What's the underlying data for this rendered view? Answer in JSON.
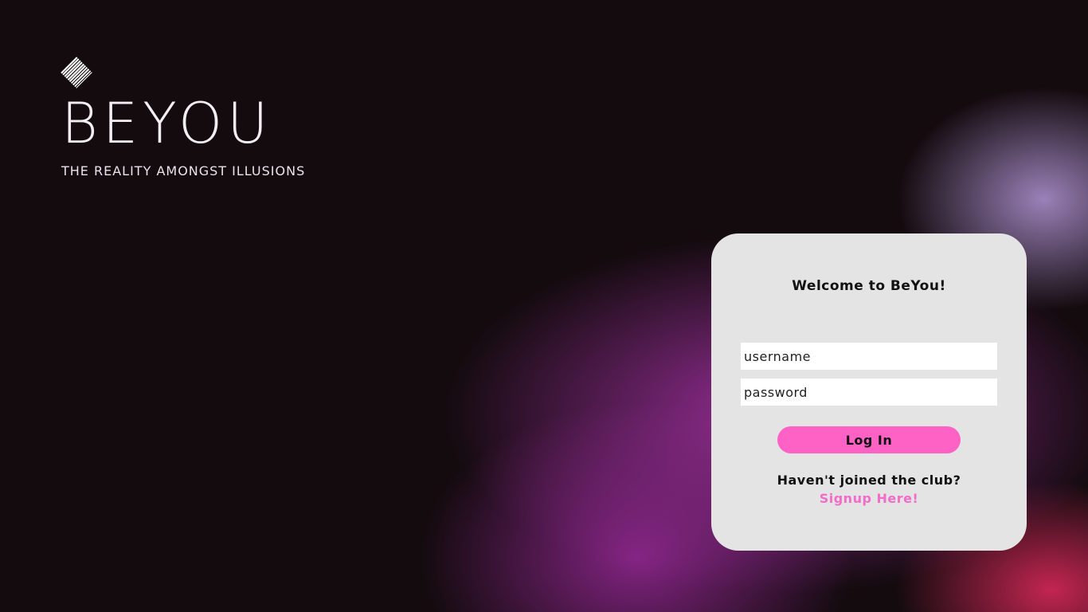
{
  "brand": {
    "logo_icon": "diamond-logo-icon",
    "title": "BEYOU",
    "tagline": "THE REALITY AMONGST ILLUSIONS"
  },
  "login": {
    "heading": "Welcome to BeYou!",
    "username_placeholder": "username",
    "password_placeholder": "password",
    "login_label": "Log In",
    "join_prompt": "Haven't joined the club?",
    "signup_label": "Signup Here!"
  },
  "colors": {
    "background": "#140b0f",
    "card": "#e4e4e4",
    "accent": "#ff62c5",
    "link": "#f36dc8"
  }
}
